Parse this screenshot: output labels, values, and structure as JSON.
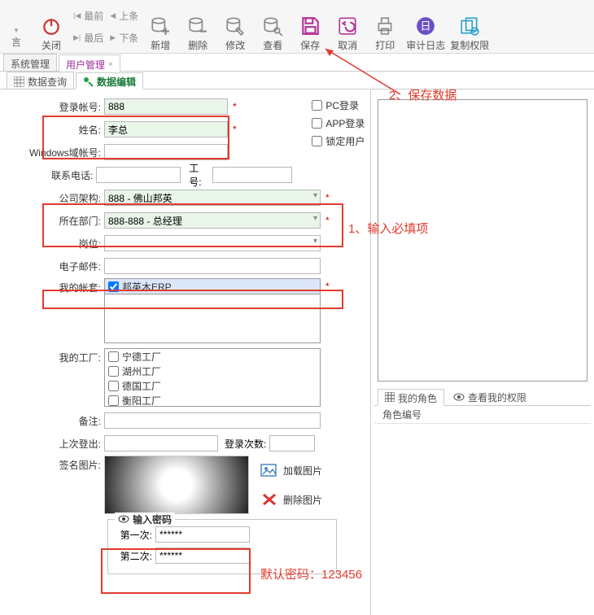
{
  "ribbon": {
    "left_partial": "言",
    "close": "关闭",
    "first": "最前",
    "last": "最后",
    "prev": "上条",
    "next": "下条",
    "add": "新增",
    "delete": "删除",
    "modify": "修改",
    "view": "查看",
    "save": "保存",
    "cancel": "取消",
    "print": "打印",
    "audit": "审计日志",
    "copyperm": "复制权限"
  },
  "tabs1": {
    "sys": "系统管理",
    "user": "用户管理"
  },
  "tabs2": {
    "query": "数据查询",
    "edit": "数据编辑"
  },
  "form": {
    "login_account_label": "登录帐号:",
    "login_account_value": "888",
    "name_label": "姓名:",
    "name_value": "李总",
    "windows_label": "Windows域帐号:",
    "phone_label": "联系电话:",
    "jobno_label": "工号:",
    "company_label": "公司架构:",
    "company_value": "888 - 佛山邦英",
    "dept_label": "所在部门:",
    "dept_value": "888-888 - 总经理",
    "post_label": "岗位:",
    "email_label": "电子邮件:",
    "myacct_label": "我的帐套:",
    "myacct_item": "邦英木ERP",
    "myfactory_label": "我的工厂:",
    "factories": [
      "宁德工厂",
      "湖州工厂",
      "德国工厂",
      "衡阳工厂"
    ],
    "remark_label": "备注:",
    "lastlogin_label": "上次登出:",
    "logincount_label": "登录次数:",
    "sign_label": "签名图片:",
    "load_img": "加载图片",
    "del_img": "删除图片",
    "check_pc": "PC登录",
    "check_app": "APP登录",
    "check_lock": "锁定用户"
  },
  "password_group": {
    "title": "输入密码",
    "first_label": "第一次:",
    "second_label": "第二次:",
    "mask_value": "******"
  },
  "right": {
    "my_role_tab": "我的角色",
    "view_perm_tab": "查看我的权限",
    "role_col": "角色编号"
  },
  "annotations": {
    "step1": "1、输入必填项",
    "step2": "2、保存数据",
    "default_pw": "默认密码：123456"
  }
}
